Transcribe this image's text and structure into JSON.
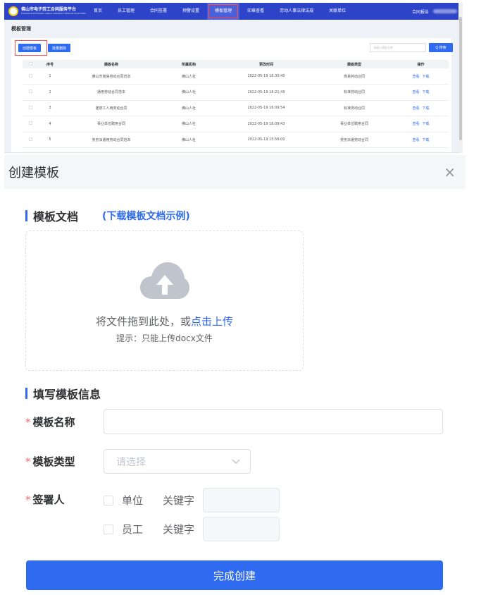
{
  "top": {
    "brand": "佛山市电子劳工合同服务平台",
    "brand_sub": "FOSHAN ELECTRONIC LABOR CONTRACT SERVICE PLATFORM",
    "nav": [
      "首页",
      "员工管理",
      "合同签署",
      "预警设置",
      "模板管理",
      "印章查看",
      "劳动人事法律法规",
      "关联单位"
    ],
    "nav_active_index": 4,
    "user": "合同报告",
    "page_title": "模板管理",
    "create_btn": "创建模板",
    "batch_delete_btn": "批量删除",
    "search_placeholder": "请输入模板名称",
    "search_btn": "Q 搜索",
    "columns": [
      "序号",
      "模板名称",
      "所属机构",
      "更改时间",
      "模板类型",
      "操作"
    ],
    "rows": [
      {
        "no": "1",
        "name": "佛山市简易劳动合同范本",
        "org": "佛山人社",
        "time": "2022-05-19 16:30:40",
        "type": "简易劳动合同"
      },
      {
        "no": "2",
        "name": "通用劳动合同范本",
        "org": "佛山人社",
        "time": "2022-05-19 16:21:49",
        "type": "标准劳动合同"
      },
      {
        "no": "3",
        "name": "建筑工人用劳动合同",
        "org": "佛山人社",
        "time": "2022-05-19 16:09:54",
        "type": "标准劳动合同"
      },
      {
        "no": "4",
        "name": "事业单位聘用合同",
        "org": "佛山人社",
        "time": "2022-05-19 16:09:43",
        "type": "事业单位聘用合同"
      },
      {
        "no": "5",
        "name": "劳务派遣用劳动合同范本",
        "org": "佛山人社",
        "time": "2022-05-19 15:56:00",
        "type": "劳务派遣劳动合同"
      }
    ],
    "op_view": "查看",
    "op_download": "下载"
  },
  "modal": {
    "title": "创建模板",
    "close": "×",
    "section_doc": "模板文档",
    "download_example": "(下载模板文档示例)",
    "upload_text": "将文件拖到此处，或",
    "upload_link": "点击上传",
    "upload_tip": "提示：只能上传docx文件",
    "section_info": "填写模板信息",
    "label_name": "模板名称",
    "label_type": "模板类型",
    "type_placeholder": "请选择",
    "label_signer": "签署人",
    "signer_unit": "单位",
    "signer_employee": "员工",
    "keyword_label": "关键字",
    "required_mark": "*",
    "finish_btn": "完成创建"
  },
  "colors": {
    "primary": "#2f6bf0",
    "nav_bg": "#2d44c9",
    "highlight": "#ff4d4f",
    "required": "#f56c6c"
  }
}
